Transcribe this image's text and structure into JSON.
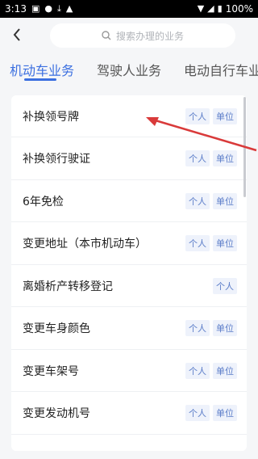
{
  "status_bar": {
    "time": "3:13",
    "battery": "100%"
  },
  "search": {
    "placeholder": "搜索办理的业务"
  },
  "tabs": [
    {
      "label": "机动车业务",
      "active": true
    },
    {
      "label": "驾驶人业务",
      "active": false
    },
    {
      "label": "电动自行车业务",
      "active": false
    }
  ],
  "services": [
    {
      "name": "补换领号牌",
      "tags": [
        "个人",
        "单位"
      ]
    },
    {
      "name": "补换领行驶证",
      "tags": [
        "个人",
        "单位"
      ]
    },
    {
      "name": "6年免检",
      "tags": [
        "个人",
        "单位"
      ]
    },
    {
      "name": "变更地址（本市机动车）",
      "tags": [
        "个人",
        "单位"
      ]
    },
    {
      "name": "离婚析产转移登记",
      "tags": [
        "个人"
      ]
    },
    {
      "name": "变更车身颜色",
      "tags": [
        "个人",
        "单位"
      ]
    },
    {
      "name": "变更车架号",
      "tags": [
        "个人",
        "单位"
      ]
    },
    {
      "name": "变更发动机号",
      "tags": [
        "个人",
        "单位"
      ]
    }
  ],
  "colors": {
    "accent": "#3b6fe0",
    "tag_text": "#5a7cc8",
    "tag_bg": "#eef2fb",
    "annotation_arrow": "#d93a3a"
  }
}
